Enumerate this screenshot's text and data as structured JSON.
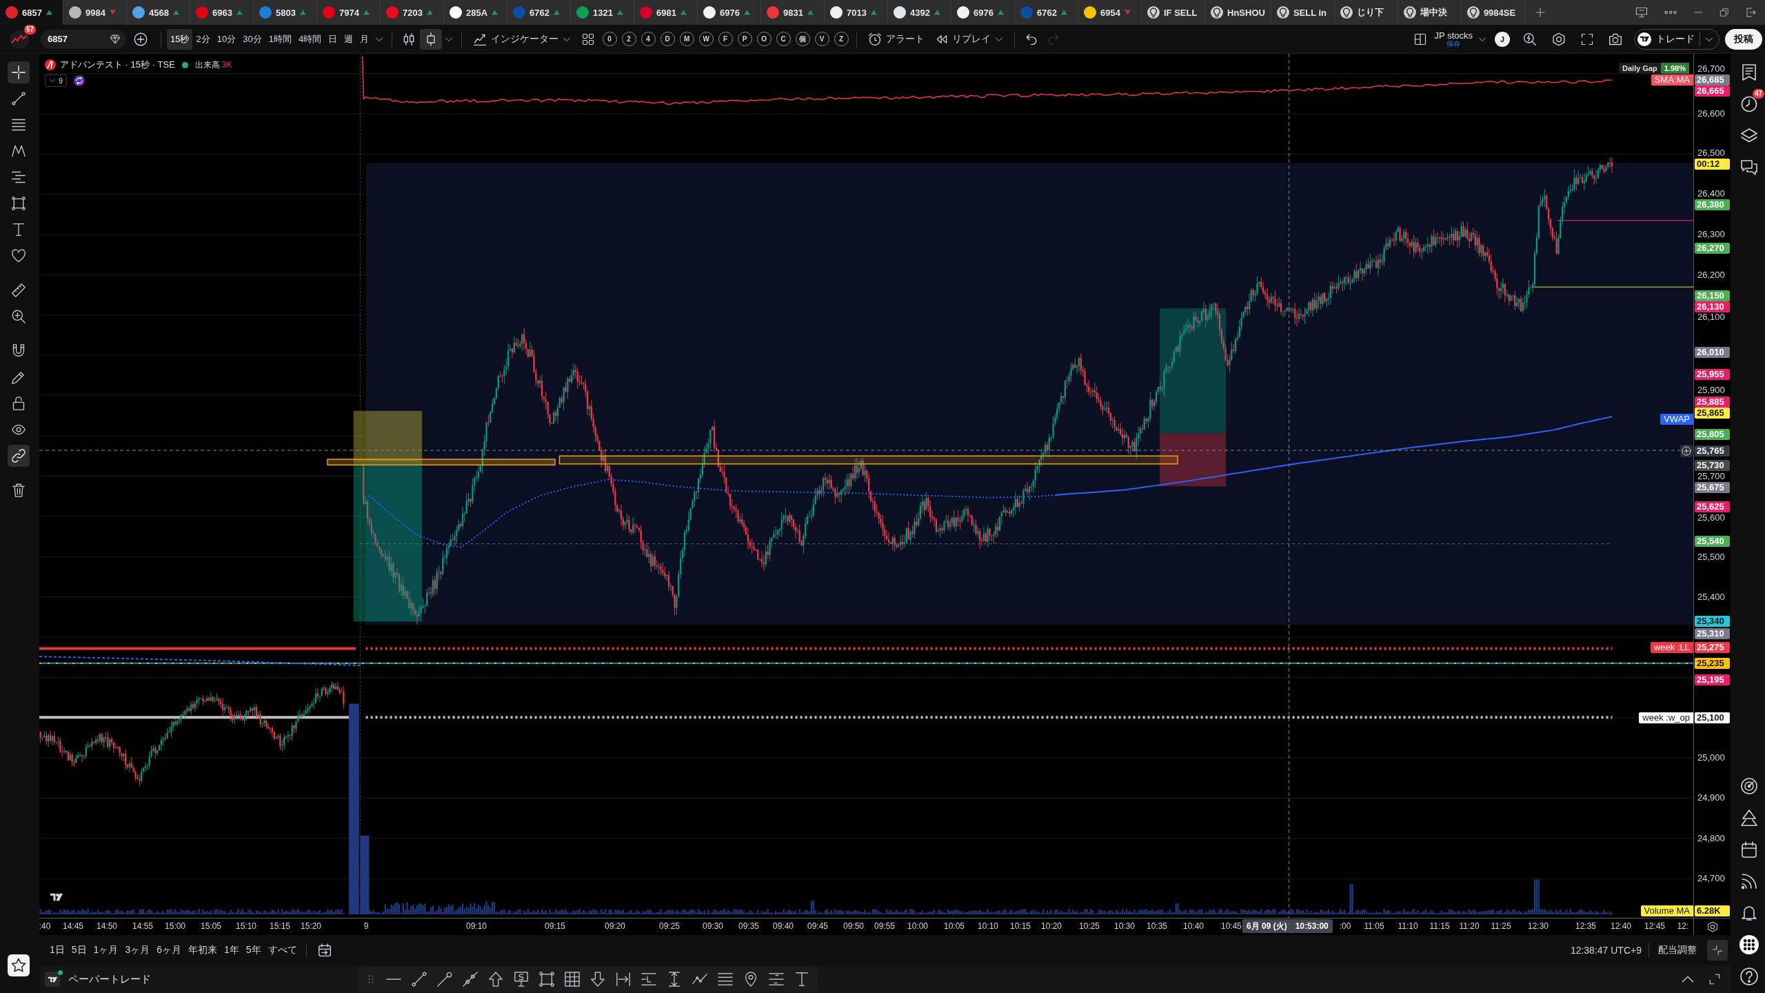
{
  "symbol_tabs": [
    {
      "label": "6857",
      "up": true,
      "color": "#e0242c",
      "selected": true
    },
    {
      "label": "9984",
      "up": false,
      "color": "#b8b8b8",
      "selected": false
    },
    {
      "label": "4568",
      "up": true,
      "color": "#4fa3e0",
      "selected": false
    },
    {
      "label": "6963",
      "up": true,
      "color": "#e60012",
      "selected": false
    },
    {
      "label": "5803",
      "up": true,
      "color": "#1e7fd8",
      "selected": false
    },
    {
      "label": "7974",
      "up": true,
      "color": "#e50011",
      "selected": false
    },
    {
      "label": "7203",
      "up": true,
      "color": "#eb0a1e",
      "selected": false
    },
    {
      "label": "285A",
      "up": true,
      "color": "#ffffff",
      "selected": false
    },
    {
      "label": "6762",
      "up": true,
      "color": "#0b4ea2",
      "selected": false
    },
    {
      "label": "1321",
      "up": true,
      "color": "#0f9d58",
      "selected": false
    },
    {
      "label": "6981",
      "up": true,
      "color": "#d7002a",
      "selected": false
    },
    {
      "label": "6976",
      "up": true,
      "color": "#f4f4f4",
      "selected": false
    },
    {
      "label": "9831",
      "up": true,
      "color": "#e8383d",
      "selected": false
    },
    {
      "label": "7013",
      "up": true,
      "color": "#eeeeee",
      "selected": false
    },
    {
      "label": "4392",
      "up": true,
      "color": "#dfe6ee",
      "selected": false
    },
    {
      "label": "6976",
      "up": true,
      "color": "#f4f4f3",
      "selected": false
    },
    {
      "label": "6762",
      "up": true,
      "color": "#0b4ea3",
      "selected": false
    },
    {
      "label": "6954",
      "up": false,
      "color": "#f5c400",
      "selected": false
    }
  ],
  "alert_tabs": [
    {
      "label": "IF SELL",
      "selected": false
    },
    {
      "label": "HnSHOU",
      "selected": false
    },
    {
      "label": "SELL in",
      "selected": false
    },
    {
      "label": "じり下",
      "selected": false
    },
    {
      "label": "場中決",
      "selected": false
    },
    {
      "label": "9984SE",
      "selected": false
    }
  ],
  "toolbar": {
    "avatar_badge": "57",
    "symbol": "6857",
    "intervals": [
      {
        "label": "15秒",
        "selected": true
      },
      {
        "label": "2分",
        "selected": false
      },
      {
        "label": "10分",
        "selected": false
      },
      {
        "label": "30分",
        "selected": false
      },
      {
        "label": "1時間",
        "selected": false
      },
      {
        "label": "4時間",
        "selected": false
      },
      {
        "label": "日",
        "selected": false
      },
      {
        "label": "週",
        "selected": false
      },
      {
        "label": "月",
        "selected": false
      }
    ],
    "chart_styles": [
      {
        "kind": "candles",
        "selected": false
      },
      {
        "kind": "hollow-candles",
        "selected": true
      }
    ],
    "indicators_label": "インジケーター",
    "quick_buttons": [
      "0",
      "2",
      "4",
      "D",
      "M",
      "W",
      "F",
      "P",
      "O",
      "C",
      "個",
      "V",
      "Z"
    ],
    "alert_label": "アラート",
    "replay_label": "リプレイ",
    "history": [
      {
        "kind": "undo",
        "disabled": false
      },
      {
        "kind": "redo",
        "disabled": true
      }
    ],
    "layout_name": "JP stocks",
    "layout_status": "保存",
    "user_initial": "J",
    "trade_label": "トレード",
    "publish_label": "投稿"
  },
  "drawing_tools": [
    {
      "kind": "crosshair",
      "selected": true
    },
    {
      "kind": "trend-line",
      "selected": false
    },
    {
      "kind": "fibonacci",
      "selected": false
    },
    {
      "kind": "pattern",
      "selected": false
    },
    {
      "kind": "projection",
      "selected": false
    },
    {
      "kind": "shapes",
      "selected": false
    },
    {
      "kind": "text",
      "selected": false
    },
    {
      "kind": "favorites",
      "selected": false
    },
    {
      "kind": "measure",
      "selected": false
    },
    {
      "kind": "zoom",
      "selected": false
    },
    {
      "kind": "magnet",
      "selected": false
    },
    {
      "kind": "stay-drawing",
      "selected": false
    },
    {
      "kind": "lock",
      "selected": false
    },
    {
      "kind": "hide",
      "selected": false
    },
    {
      "kind": "sync",
      "selected": true
    },
    {
      "kind": "remove",
      "selected": false
    }
  ],
  "chart": {
    "legend": {
      "title": "アドバンテスト · 15秒 · TSE",
      "market_open": true,
      "volume_label": "出来高",
      "volume_value": "3K",
      "indicator_count": "9"
    },
    "daily_gap": {
      "label": "Daily Gap",
      "value": "1.98%"
    },
    "price_ticks": [
      "26,700",
      "26,600",
      "26,500",
      "26,400",
      "26,300",
      "26,200",
      "26,100",
      "25,900",
      "25,700",
      "25,600",
      "25,500",
      "25,400",
      "25,000",
      "24,900",
      "24,800",
      "24,700"
    ],
    "price_labels": [
      {
        "value": "26,685",
        "color": "#787b86",
        "tag": {
          "label": "SMA:MA",
          "color": "#f7525f"
        }
      },
      {
        "value": "26,665",
        "color": "#e91e63"
      },
      {
        "value": "00:12",
        "color": "#ffeb3b"
      },
      {
        "value": "26,380",
        "color": "#4caf50"
      },
      {
        "value": "26,270",
        "color": "#4caf51"
      },
      {
        "value": "26,150",
        "color": "#4caf52"
      },
      {
        "value": "26,130",
        "color": "#e91e64"
      },
      {
        "value": "26,010",
        "color": "#787b87"
      },
      {
        "value": "25,955",
        "color": "#e91e65"
      },
      {
        "value": "25,885",
        "color": "#e91e66"
      },
      {
        "value": "25,865",
        "color": "#ffeb3c"
      },
      {
        "tag": {
          "label": "VWAP",
          "color": "#2962ff"
        }
      },
      {
        "value": "25,805",
        "color": "#4caf53"
      },
      {
        "value": "25,765",
        "color": "#363a45"
      },
      {
        "value": "25,730",
        "color": "#4a4a4a"
      },
      {
        "value": "25,675",
        "color": "#787b88"
      },
      {
        "value": "25,625",
        "color": "#e91e67"
      },
      {
        "value": "25,540",
        "color": "#4caf54"
      },
      {
        "value": "25,340",
        "color": "#26c6da"
      },
      {
        "value": "25,310",
        "color": "#787b89"
      },
      {
        "value": "25,275",
        "color": "#f23645",
        "tag": {
          "label": "week :LL",
          "color": "#f23645"
        }
      },
      {
        "value": "25,235",
        "color": "#ffc107"
      },
      {
        "value": "25,195",
        "color": "#e91e68"
      },
      {
        "value": "25,100",
        "color": "#ffffff",
        "tag": {
          "label": "week :w_op",
          "color": "#ffffff"
        }
      },
      {
        "value": "6.28K",
        "color": "#ffeb3d",
        "tag": {
          "label": "Volume MA",
          "color": "#ffeb3d"
        }
      }
    ]
  },
  "time_axis": {
    "labels": [
      ":40",
      "14:45",
      "14:50",
      "14:55",
      "15:00",
      "15:05",
      "15:10",
      "15:15",
      "15:20",
      "9",
      "09:10",
      "09:15",
      "09:20",
      "09:25",
      "09:30",
      "09:35",
      "09:40",
      "09:45",
      "09:50",
      "09:55",
      "10:00",
      "10:05",
      "10:10",
      "10:15",
      "10:20",
      "10:25",
      "10:30",
      "10:35",
      "10:40",
      "10:45",
      ":00",
      "11:05",
      "11:10",
      "11:15",
      "11:20",
      "11:25",
      "12:30",
      "12:35",
      "12:40",
      "12:45",
      "12:"
    ],
    "crosshair_date": "6月 09 (火)",
    "crosshair_time": "10:53:00"
  },
  "range_bar": {
    "ranges": [
      "1日",
      "5日",
      "1ヶ月",
      "3ヶ月",
      "6ヶ月",
      "年初来",
      "1年",
      "5年",
      "すべて"
    ],
    "clock": "12:38:47 UTC+9",
    "adjustment": "配当調整"
  },
  "bottom_panel": {
    "title": "ペーパートレード",
    "connected": true
  },
  "right_sidebar": {
    "alerts_badge": "47"
  }
}
